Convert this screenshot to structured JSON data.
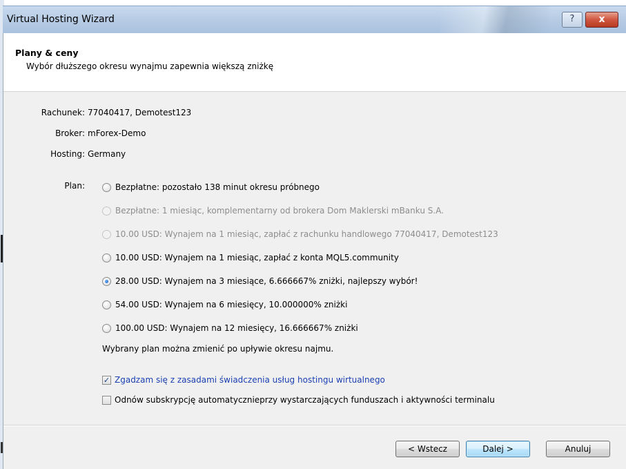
{
  "window": {
    "title": "Virtual Hosting Wizard",
    "help_glyph": "?",
    "close_glyph": "x"
  },
  "header": {
    "title": "Plany & ceny",
    "subtitle": "Wybór dłuższego okresu wynajmu zapewnia większą zniżkę"
  },
  "info": {
    "account_label": "Rachunek:",
    "account_value": "77040417, Demotest123",
    "broker_label": "Broker:",
    "broker_value": "mForex-Demo",
    "hosting_label": "Hosting:",
    "hosting_value": "Germany"
  },
  "plan": {
    "label": "Plan:",
    "options": [
      {
        "text": "Bezpłatne: pozostało 138 minut okresu próbnego",
        "enabled": true,
        "selected": false
      },
      {
        "text": "Bezpłatne: 1 miesiąc, komplementarny od brokera Dom Maklerski mBanku S.A.",
        "enabled": false,
        "selected": false
      },
      {
        "text": "10.00 USD: Wynajem na 1 miesiąc, zapłać z rachunku handlowego 77040417, Demotest123",
        "enabled": false,
        "selected": false
      },
      {
        "text": "10.00 USD: Wynajem na 1 miesiąc, zapłać z konta MQL5.community",
        "enabled": true,
        "selected": false
      },
      {
        "text": "28.00 USD: Wynajem na 3 miesiące, 6.666667% zniżki, najlepszy wybór!",
        "enabled": true,
        "selected": true
      },
      {
        "text": "54.00 USD: Wynajem na 6 miesięcy, 10.000000% zniżki",
        "enabled": true,
        "selected": false
      },
      {
        "text": "100.00 USD: Wynajem na 12 miesięcy, 16.666667% zniżki",
        "enabled": true,
        "selected": false
      }
    ],
    "note": "Wybrany plan można zmienić po upływie okresu najmu."
  },
  "checkboxes": {
    "agree": {
      "text": "Zgadzam się z zasadami świadczenia usług hostingu wirtualnego",
      "checked": true
    },
    "renew": {
      "text": "Odnów subskrypcję automatycznieprzy wystarczających funduszach i aktywności terminalu",
      "checked": false
    }
  },
  "buttons": {
    "back": "< Wstecz",
    "next": "Dalej >",
    "cancel": "Anuluj"
  },
  "colors": {
    "titlebar": "#b8cde5",
    "link_text": "#1a3fb3",
    "disabled_text": "#8d8d8d",
    "close_button": "#c8462e"
  }
}
